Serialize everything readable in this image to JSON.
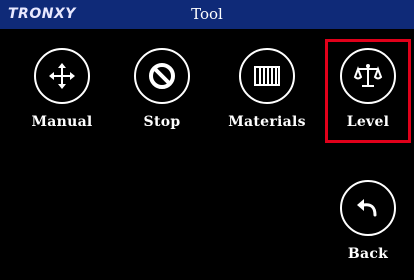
{
  "header": {
    "brand": "TRONXY",
    "title": "Tool"
  },
  "buttons": {
    "manual": {
      "label": "Manual",
      "icon": "move-arrows-icon"
    },
    "stop": {
      "label": "Stop",
      "icon": "stop-icon"
    },
    "materials": {
      "label": "Materials",
      "icon": "filament-icon"
    },
    "level": {
      "label": "Level",
      "icon": "balance-scale-icon"
    },
    "back": {
      "label": "Back",
      "icon": "back-arrow-icon"
    }
  },
  "colors": {
    "titlebar": "#0f2a78",
    "background": "#000000",
    "highlight": "#e0001a",
    "foreground": "#ffffff"
  }
}
